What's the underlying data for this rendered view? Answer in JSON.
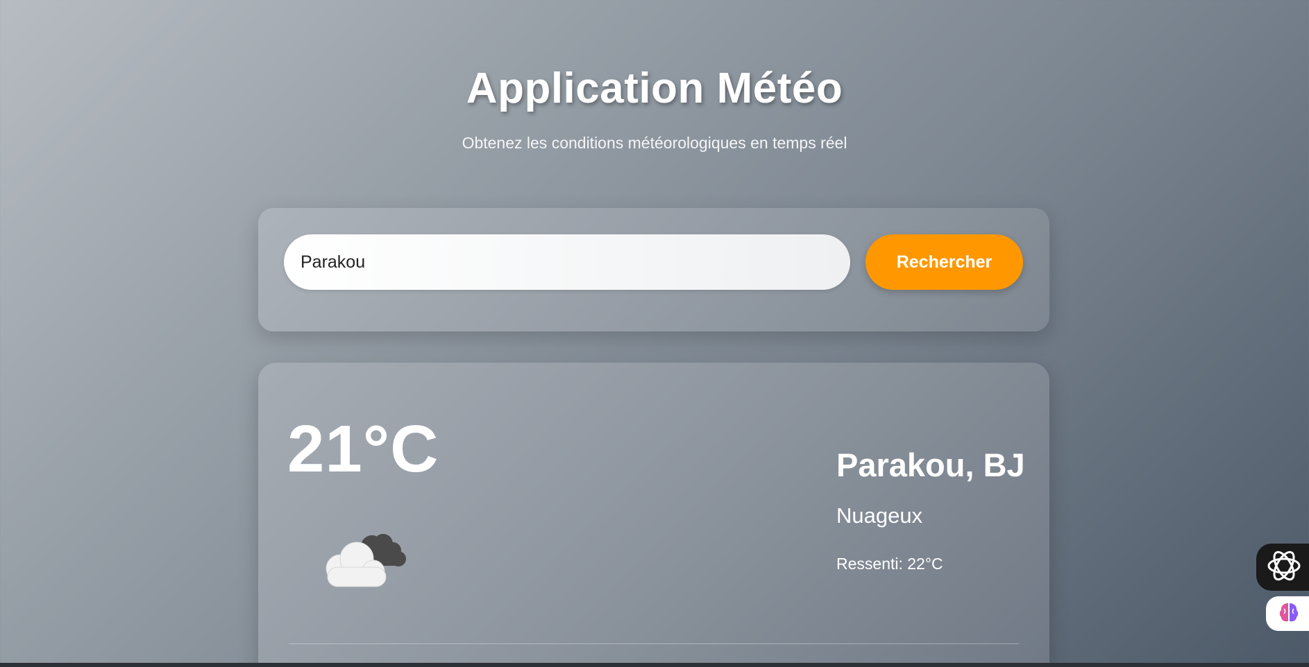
{
  "header": {
    "title": "Application Météo",
    "subtitle": "Obtenez les conditions météorologiques en temps réel"
  },
  "search": {
    "value": "Parakou",
    "button_label": "Rechercher"
  },
  "weather": {
    "temperature": "21°C",
    "city": "Parakou, BJ",
    "condition": "Nuageux",
    "feels_like": "Ressenti: 22°C",
    "icon": "cloud-icon"
  },
  "side_widgets": {
    "widget1_icon": "openai-icon",
    "widget2_icon": "brain-icon"
  },
  "colors": {
    "accent": "#ff9800",
    "text": "#ffffff"
  }
}
